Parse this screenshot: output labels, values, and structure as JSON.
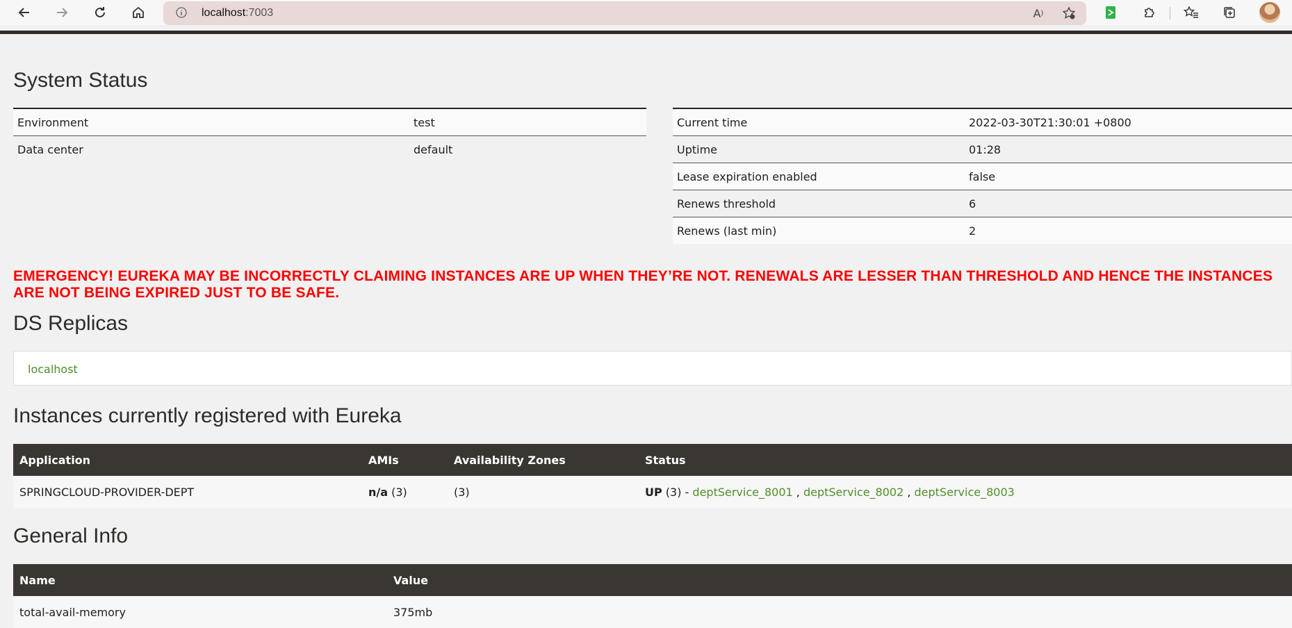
{
  "browser": {
    "url_host": "localhost",
    "url_port": ":7003",
    "read_aloud_label": "A",
    "accent_color": "#e8d8d8"
  },
  "system_status": {
    "title": "System Status",
    "left": [
      {
        "label": "Environment",
        "value": "test"
      },
      {
        "label": "Data center",
        "value": "default"
      }
    ],
    "right": [
      {
        "label": "Current time",
        "value": "2022-03-30T21:30:01 +0800"
      },
      {
        "label": "Uptime",
        "value": "01:28"
      },
      {
        "label": "Lease expiration enabled",
        "value": "false"
      },
      {
        "label": "Renews threshold",
        "value": "6"
      },
      {
        "label": "Renews (last min)",
        "value": "2"
      }
    ]
  },
  "emergency": {
    "text": "EMERGENCY! EUREKA MAY BE INCORRECTLY CLAIMING INSTANCES ARE UP WHEN THEY’RE NOT. RENEWALS ARE LESSER THAN THRESHOLD AND HENCE THE INSTANCES ARE NOT BEING EXPIRED JUST TO BE SAFE.",
    "color": "#ff0000"
  },
  "replicas": {
    "title": "DS Replicas",
    "link": "localhost"
  },
  "instances": {
    "title": "Instances currently registered with Eureka",
    "headers": [
      "Application",
      "AMIs",
      "Availability Zones",
      "Status"
    ],
    "row": {
      "application": "SPRINGCLOUD-PROVIDER-DEPT",
      "amis_bold": "n/a",
      "amis_count": " (3)",
      "zones": "(3)",
      "status_bold": "UP",
      "status_prefix": " (3) - ",
      "links": [
        "deptService_8001",
        "deptService_8002",
        "deptService_8003"
      ],
      "sep": " , "
    }
  },
  "general_info": {
    "title": "General Info",
    "headers": [
      "Name",
      "Value"
    ],
    "rows": [
      {
        "name": "total-avail-memory",
        "value": "375mb"
      }
    ]
  }
}
